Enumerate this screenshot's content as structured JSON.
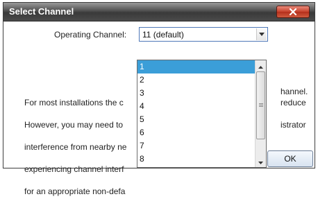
{
  "dialog": {
    "title": "Select Channel",
    "close_icon": "close-x-icon"
  },
  "channel": {
    "label": "Operating Channel:",
    "selected_value": "11 (default)",
    "dropdown_icon": "chevron-down-icon",
    "options": [
      "1",
      "2",
      "3",
      "4",
      "5",
      "6",
      "7",
      "8"
    ],
    "highlighted_option": "1"
  },
  "description": {
    "lines": [
      "For most installations the c",
      "However, you may need to",
      "interference from nearby ne",
      "experiencing channel interf",
      "for an appropriate non-defa"
    ],
    "right_fragments": [
      "hannel.",
      "reduce",
      "",
      "istrator",
      ""
    ]
  },
  "buttons": {
    "ok_label": "OK"
  },
  "colors": {
    "selection": "#3b9ed8",
    "combo_border": "#4f78b8",
    "close_button": "#c7422c"
  }
}
